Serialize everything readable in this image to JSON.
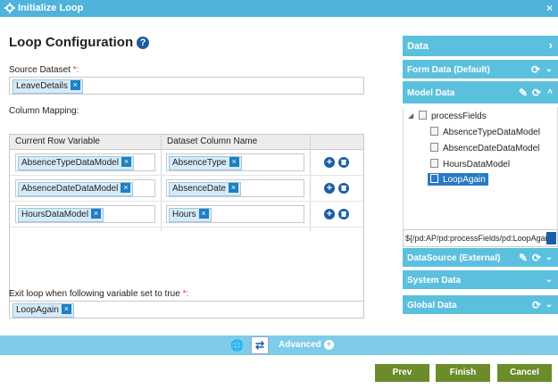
{
  "window": {
    "title": "Initialize Loop",
    "close_glyph": "×",
    "gear_icon": "gear-icon"
  },
  "main": {
    "heading": "Loop Configuration",
    "help_glyph": "?",
    "source_label": "Source Dataset",
    "required_mark": "*:",
    "source_tag": "LeaveDetails",
    "mapping_label": "Column Mapping:",
    "col1": "Current Row Variable",
    "col2": "Dataset Column Name",
    "rows": [
      {
        "var": "AbsenceTypeDataModel",
        "col": "AbsenceType"
      },
      {
        "var": "AbsenceDateDataModel",
        "col": "AbsenceDate"
      },
      {
        "var": "HoursDataModel",
        "col": "Hours"
      }
    ],
    "exit_label": "Exit loop when following variable set to true",
    "exit_tag": "LoopAgain",
    "tag_remove": "×",
    "add_glyph": "+"
  },
  "panel": {
    "data": "Data",
    "form_data": "Form Data (Default)",
    "model_data": "Model Data",
    "tree_root": "processFields",
    "tree_items": [
      "AbsenceTypeDataModel",
      "AbsenceDateDataModel",
      "HoursDataModel",
      "LoopAgain"
    ],
    "path_value": "${/pd:AP/pd:processFields/pd:LoopAgain}",
    "datasource": "DataSource (External)",
    "system_data": "System Data",
    "global_data": "Global Data",
    "chevron_right": "›",
    "chevron_down": "⌄",
    "chevron_up": "˄",
    "refresh_glyph": "⟳",
    "edit_glyph": "✎",
    "expand_glyph": "◢"
  },
  "footer": {
    "advanced": "Advanced",
    "plus": "+",
    "globe": "🌐",
    "loop_glyph": "⇄"
  },
  "buttons": {
    "prev": "Prev",
    "finish": "Finish",
    "cancel": "Cancel"
  },
  "colors": {
    "accent": "#4fb3dc",
    "panel_bar": "#5bc0de",
    "button_green": "#6b8c2a",
    "selected": "#2a79c5"
  }
}
